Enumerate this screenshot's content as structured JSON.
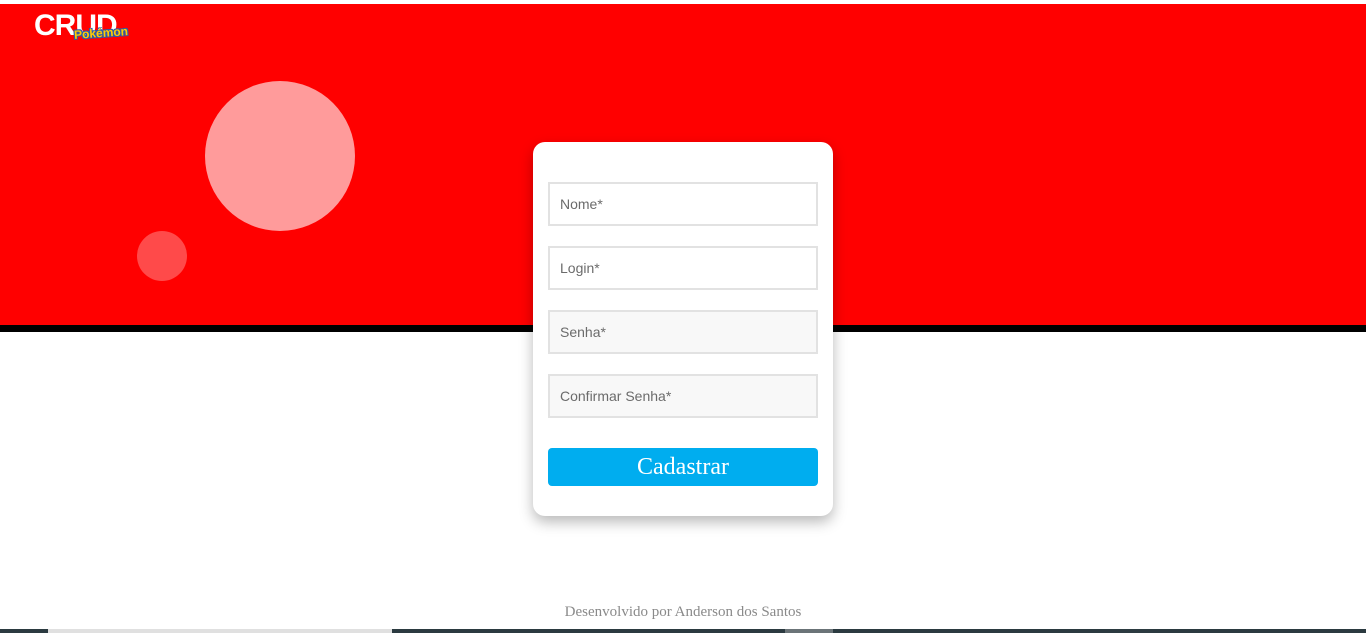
{
  "header": {
    "logo_main": "CRUD",
    "logo_sub": "Pokémon"
  },
  "colors": {
    "hero_background": "#ff0000",
    "accent_button": "#00adef"
  },
  "form": {
    "nome_placeholder": "Nome*",
    "login_placeholder": "Login*",
    "senha_placeholder": "Senha*",
    "confirmar_placeholder": "Confirmar Senha*",
    "submit_label": "Cadastrar"
  },
  "footer": {
    "credit": "Desenvolvido por Anderson dos Santos"
  }
}
